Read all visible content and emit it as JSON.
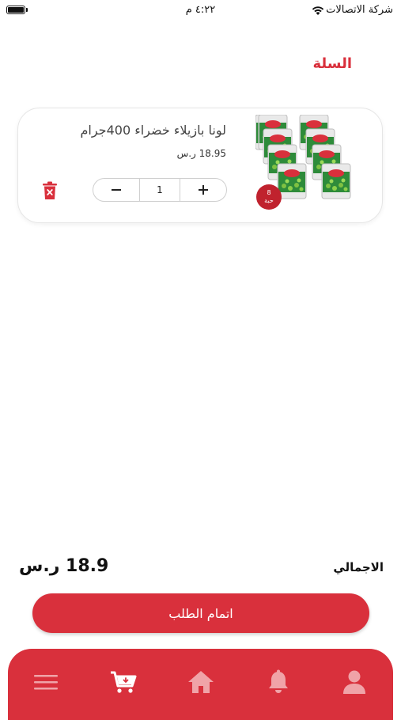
{
  "status_bar": {
    "carrier": "شركة الاتصالات",
    "time": "٤:٢٢ م"
  },
  "page": {
    "title": "السلة"
  },
  "cart_item": {
    "name": "لونا بازيلاء خضراء 400جرام",
    "price": "18.95 ر.س",
    "quantity": "1",
    "badge_count": "8",
    "badge_unit": "حبة"
  },
  "summary": {
    "total_label": "الاجمالي",
    "total_value": "18.9 ر.س"
  },
  "checkout": {
    "label": "اتمام الطلب"
  },
  "bottom_nav": {
    "items": [
      "menu-icon",
      "cart-icon",
      "home-icon",
      "bell-icon",
      "user-icon"
    ],
    "active": "cart-icon"
  },
  "colors": {
    "accent": "#d9303c",
    "badge": "#c0222e",
    "nav_inactive": "#f0a3a8"
  }
}
